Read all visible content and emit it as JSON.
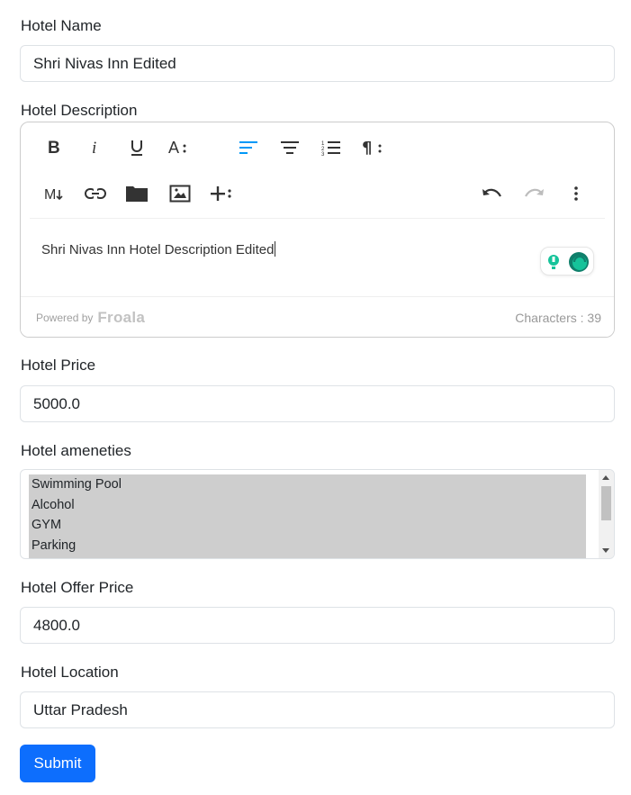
{
  "form": {
    "hotel_name": {
      "label": "Hotel Name",
      "value": "Shri Nivas Inn Edited"
    },
    "hotel_description": {
      "label": "Hotel Description",
      "content": "Shri Nivas Inn Hotel Description Edited",
      "powered_by": "Powered by",
      "brand": "Froala",
      "char_count": "Characters : 39"
    },
    "hotel_price": {
      "label": "Hotel Price",
      "value": "5000.0"
    },
    "hotel_amenities": {
      "label": "Hotel ameneties",
      "options": [
        "Swimming Pool",
        "Alcohol",
        "GYM",
        "Parking"
      ]
    },
    "hotel_offer_price": {
      "label": "Hotel Offer Price",
      "value": "4800.0"
    },
    "hotel_location": {
      "label": "Hotel Location",
      "value": "Uttar Pradesh"
    },
    "submit_label": "Submit"
  },
  "toolbar": {
    "row1": [
      "bold-icon",
      "italic-icon",
      "underline-icon",
      "font-size-icon",
      "align-left-icon",
      "align-center-icon",
      "ordered-list-icon",
      "paragraph-format-icon"
    ],
    "row2": [
      "markdown-icon",
      "link-icon",
      "folder-icon",
      "image-icon",
      "more-insert-icon",
      "undo-icon",
      "redo-icon",
      "more-options-icon"
    ]
  },
  "colors": {
    "accent": "#0d6efd",
    "active_align": "#0098f7",
    "grammarly": "#15c39a"
  }
}
